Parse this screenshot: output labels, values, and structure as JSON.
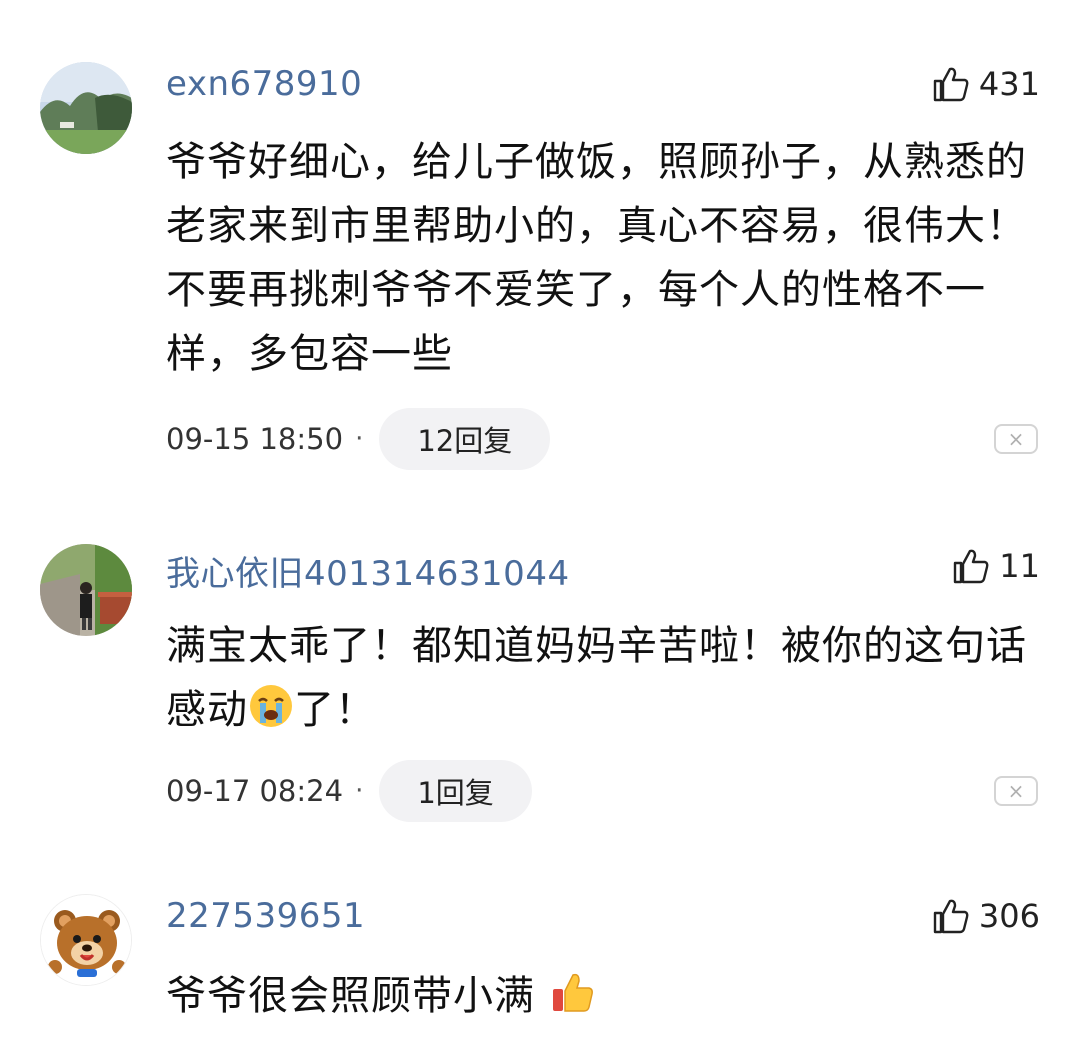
{
  "comments": [
    {
      "username": "exn678910",
      "likes": "431",
      "text": "爷爷好细心，给儿子做饭，照顾孙子，从熟悉的老家来到市里帮助小的，真心不容易，很伟大！不要再挑刺爷爷不爱笑了，每个人的性格不一样，多包容一些",
      "time": "09-15 18:50",
      "replies": "12回复",
      "avatar_icon": "landscape-avatar"
    },
    {
      "username": "我心依旧401314631044",
      "likes": "11",
      "text_before": "满宝太乖了！都知道妈妈辛苦啦！被你的这句话感动",
      "emoji": "crying-face-emoji",
      "text_after": "了！",
      "time": "09-17 08:24",
      "replies": "1回复",
      "avatar_icon": "person-avatar"
    },
    {
      "username": "227539651",
      "likes": "306",
      "text": "爷爷很会照顾带小满",
      "emoji": "thumbs-up-emoji",
      "avatar_icon": "bear-avatar"
    }
  ],
  "separator": "·",
  "close_symbol": "×",
  "colors": {
    "username": "#4a6c9b",
    "reply_bg": "#f2f2f4",
    "text": "#111111"
  }
}
